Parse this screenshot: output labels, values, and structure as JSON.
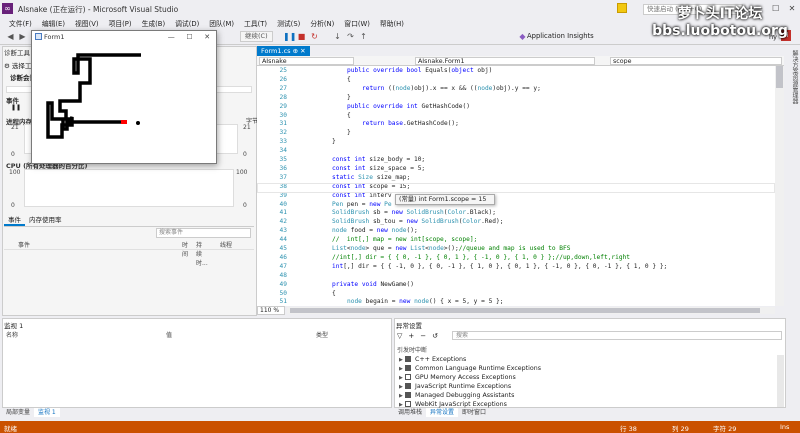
{
  "window": {
    "title": "AIsnake (正在运行) - Microsoft Visual Studio",
    "quick_launch_placeholder": "快速启动 (Ctrl+Q)",
    "user": "hy",
    "user_initial": "H"
  },
  "menu": [
    "文件(F)",
    "编辑(E)",
    "视图(V)",
    "项目(P)",
    "生成(B)",
    "调试(D)",
    "团队(M)",
    "工具(T)",
    "测试(S)",
    "分析(N)",
    "窗口(W)",
    "帮助(H)"
  ],
  "toolbar": {
    "continue_label": "继续(C)",
    "app_insights_label": "Application Insights"
  },
  "diagnostics": {
    "title": "诊断工具",
    "select_tools": "选择工具",
    "session_label": "诊断会话",
    "events_label": "事件",
    "process_memory_label": "进程内存",
    "cpu_label": "CPU (所有处理器的百分比)",
    "mem_max": "21",
    "mem_min": "0",
    "cpu_max": "100",
    "cpu_min": "0",
    "time_fragment": "5秒",
    "byte_fragment": "字节",
    "tabs": [
      "事件",
      "内存使用率"
    ],
    "search_placeholder": "搜索事件",
    "columns": [
      "事件",
      "时间",
      "持续时...",
      "线程"
    ]
  },
  "form1": {
    "title": "Form1",
    "snake_color": "#000000",
    "head_color": "#ff0000"
  },
  "editor": {
    "tab": "Form1.cs",
    "class_dropdown": "AIsnake",
    "member_dropdown": "AIsnake.Form1",
    "scope_dropdown": "scope",
    "zoom": "110 %",
    "tooltip": "(常量) int Form1.scope = 15",
    "lines": [
      {
        "n": "25",
        "indent": 3,
        "parts": [
          [
            "kw",
            "public "
          ],
          [
            "kw",
            "override "
          ],
          [
            "kw",
            "bool "
          ],
          [
            "",
            "Equals("
          ],
          [
            "kw",
            "object "
          ],
          [
            "",
            "obj)"
          ]
        ]
      },
      {
        "n": "26",
        "indent": 3,
        "parts": [
          [
            "",
            "{"
          ]
        ]
      },
      {
        "n": "27",
        "indent": 4,
        "parts": [
          [
            "kw",
            "return "
          ],
          [
            "",
            "(("
          ],
          [
            "ty",
            "node"
          ],
          [
            "",
            ")obj).x == x && (("
          ],
          [
            "ty",
            "node"
          ],
          [
            "",
            ")obj).y == y;"
          ]
        ]
      },
      {
        "n": "28",
        "indent": 3,
        "parts": [
          [
            "",
            "}"
          ]
        ]
      },
      {
        "n": "29",
        "indent": 3,
        "parts": [
          [
            "kw",
            "public "
          ],
          [
            "kw",
            "override "
          ],
          [
            "kw",
            "int "
          ],
          [
            "",
            "GetHashCode()"
          ]
        ]
      },
      {
        "n": "30",
        "indent": 3,
        "parts": [
          [
            "",
            "{"
          ]
        ]
      },
      {
        "n": "31",
        "indent": 4,
        "parts": [
          [
            "kw",
            "return "
          ],
          [
            "kw",
            "base"
          ],
          [
            "",
            ".GetHashCode();"
          ]
        ]
      },
      {
        "n": "32",
        "indent": 3,
        "parts": [
          [
            "",
            "}"
          ]
        ]
      },
      {
        "n": "33",
        "indent": 2,
        "parts": [
          [
            "",
            "}"
          ]
        ]
      },
      {
        "n": "34",
        "indent": 0,
        "parts": []
      },
      {
        "n": "35",
        "indent": 2,
        "parts": [
          [
            "kw",
            "const "
          ],
          [
            "kw",
            "int "
          ],
          [
            "",
            "size_body = 10;"
          ]
        ]
      },
      {
        "n": "36",
        "indent": 2,
        "parts": [
          [
            "kw",
            "const "
          ],
          [
            "kw",
            "int "
          ],
          [
            "",
            "size_space = 5;"
          ]
        ]
      },
      {
        "n": "37",
        "indent": 2,
        "parts": [
          [
            "kw",
            "static "
          ],
          [
            "ty",
            "Size "
          ],
          [
            "",
            "size_map;"
          ]
        ]
      },
      {
        "n": "38",
        "indent": 2,
        "parts": [
          [
            "kw",
            "const "
          ],
          [
            "kw",
            "int "
          ],
          [
            "",
            "scope = 15;"
          ]
        ]
      },
      {
        "n": "39",
        "indent": 2,
        "parts": [
          [
            "kw",
            "const "
          ],
          [
            "kw",
            "int "
          ],
          [
            "",
            "interv"
          ]
        ]
      },
      {
        "n": "40",
        "indent": 2,
        "parts": [
          [
            "ty",
            "Pen "
          ],
          [
            "",
            "pen = "
          ],
          [
            "kw",
            "new "
          ],
          [
            "ty",
            "Pe"
          ]
        ]
      },
      {
        "n": "41",
        "indent": 2,
        "parts": [
          [
            "ty",
            "SolidBrush "
          ],
          [
            "",
            "sb = "
          ],
          [
            "kw",
            "new "
          ],
          [
            "ty",
            "SolidBrush"
          ],
          [
            "",
            "("
          ],
          [
            "ty",
            "Color"
          ],
          [
            "",
            ".Black);"
          ]
        ]
      },
      {
        "n": "42",
        "indent": 2,
        "parts": [
          [
            "ty",
            "SolidBrush "
          ],
          [
            "",
            "sb_tou = "
          ],
          [
            "kw",
            "new "
          ],
          [
            "ty",
            "SolidBrush"
          ],
          [
            "",
            "("
          ],
          [
            "ty",
            "Color"
          ],
          [
            "",
            ".Red);"
          ]
        ]
      },
      {
        "n": "43",
        "indent": 2,
        "parts": [
          [
            "ty",
            "node "
          ],
          [
            "",
            "food = "
          ],
          [
            "kw",
            "new "
          ],
          [
            "ty",
            "node"
          ],
          [
            "",
            "();"
          ]
        ]
      },
      {
        "n": "44",
        "indent": 2,
        "parts": [
          [
            "cm",
            "//  int[,] map = new int[scope, scope];"
          ]
        ]
      },
      {
        "n": "45",
        "indent": 2,
        "parts": [
          [
            "ty",
            "List"
          ],
          [
            "",
            "<"
          ],
          [
            "ty",
            "node"
          ],
          [
            "",
            "> que = "
          ],
          [
            "kw",
            "new "
          ],
          [
            "ty",
            "List"
          ],
          [
            "",
            "<"
          ],
          [
            "ty",
            "node"
          ],
          [
            "",
            ">();"
          ],
          [
            "cm",
            "//queue and map is used to BFS"
          ]
        ]
      },
      {
        "n": "46",
        "indent": 2,
        "parts": [
          [
            "cm",
            "//int[,] dir = { { 0, -1 }, { 0, 1 }, { -1, 0 }, { 1, 0 } };//up,down,left,right"
          ]
        ]
      },
      {
        "n": "47",
        "indent": 2,
        "parts": [
          [
            "kw",
            "int"
          ],
          [
            "",
            "[,] dir = { { -1, 0 }, { 0, -1 }, { 1, 0 }, { 0, 1 }, { -1, 0 }, { 0, -1 }, { 1, 0 } };"
          ]
        ]
      },
      {
        "n": "48",
        "indent": 0,
        "parts": []
      },
      {
        "n": "49",
        "indent": 2,
        "parts": [
          [
            "kw",
            "private "
          ],
          [
            "kw",
            "void "
          ],
          [
            "",
            "NewGame()"
          ]
        ]
      },
      {
        "n": "50",
        "indent": 2,
        "parts": [
          [
            "",
            "{"
          ]
        ]
      },
      {
        "n": "51",
        "indent": 3,
        "parts": [
          [
            "ty",
            "node "
          ],
          [
            "",
            "begain = "
          ],
          [
            "kw",
            "new "
          ],
          [
            "ty",
            "node"
          ],
          [
            "",
            "() { x = 5, y = 5 };"
          ]
        ]
      }
    ]
  },
  "side_tabs": "解决方案资源管理器",
  "watch": {
    "title": "监视 1",
    "columns": [
      "名称",
      "值",
      "类型"
    ]
  },
  "exceptions": {
    "title": "异常设置",
    "search_placeholder": "搜索",
    "column": "引发时中断",
    "rows": [
      {
        "label": "C++ Exceptions",
        "checked": true
      },
      {
        "label": "Common Language Runtime Exceptions",
        "checked": true
      },
      {
        "label": "GPU Memory Access Exceptions",
        "checked": false
      },
      {
        "label": "JavaScript Runtime Exceptions",
        "checked": true
      },
      {
        "label": "Managed Debugging Assistants",
        "checked": true
      },
      {
        "label": "WebKit JavaScript Exceptions",
        "checked": false
      }
    ]
  },
  "bottom_tabs_left": [
    "局部变量",
    "监视 1"
  ],
  "bottom_tabs_right": [
    "调用堆栈",
    "异常设置",
    "即时窗口"
  ],
  "status": {
    "text": "就绪",
    "line": "行 38",
    "col": "列 29",
    "char": "字符 29",
    "mode": "Ins"
  },
  "watermark": {
    "line1": "萝卜头IT论坛",
    "line2": "bbs.luobotou.org"
  }
}
